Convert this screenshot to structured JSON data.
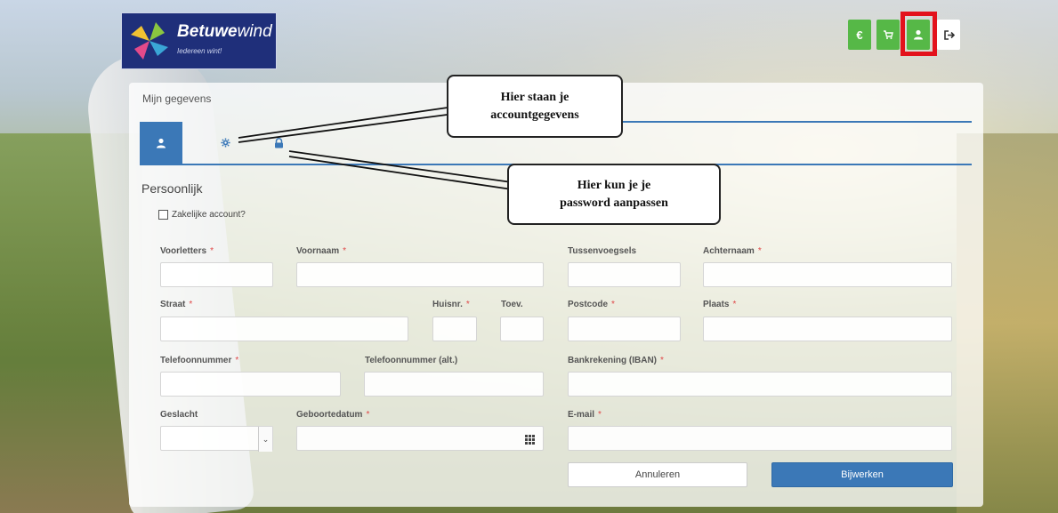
{
  "header": {
    "logo_name_bold": "Betuwe",
    "logo_name_light": "wind",
    "logo_tagline": "Iedereen wint!",
    "buttons": [
      {
        "name": "euro",
        "glyph": "€"
      },
      {
        "name": "cart",
        "glyph": "🛒"
      },
      {
        "name": "account",
        "glyph": "👤"
      },
      {
        "name": "logout",
        "glyph": "⇥"
      }
    ]
  },
  "panel": {
    "title": "Mijn gegevens",
    "section": "Persoonlijk",
    "business_account_label": "Zakelijke account?",
    "required_mark": "*"
  },
  "labels": {
    "voorletters": "Voorletters",
    "voornaam": "Voornaam",
    "tussenvoegsels": "Tussenvoegsels",
    "achternaam": "Achternaam",
    "straat": "Straat",
    "huisnr": "Huisnr.",
    "toev": "Toev.",
    "postcode": "Postcode",
    "plaats": "Plaats",
    "telefoon": "Telefoonnummer",
    "telefoon_alt": "Telefoonnummer (alt.)",
    "iban": "Bankrekening (IBAN)",
    "geslacht": "Geslacht",
    "geboortedatum": "Geboortedatum",
    "email": "E-mail"
  },
  "actions": {
    "cancel": "Annuleren",
    "update": "Bijwerken"
  },
  "callouts": {
    "account_line1": "Hier staan je",
    "account_line2": "accountgegevens",
    "password_line1": "Hier kun je je",
    "password_line2": "password aanpassen"
  },
  "colors": {
    "accent": "#3b78b7",
    "header_green": "#56b847",
    "highlight_red": "#e3121c",
    "required": "#e04848"
  }
}
